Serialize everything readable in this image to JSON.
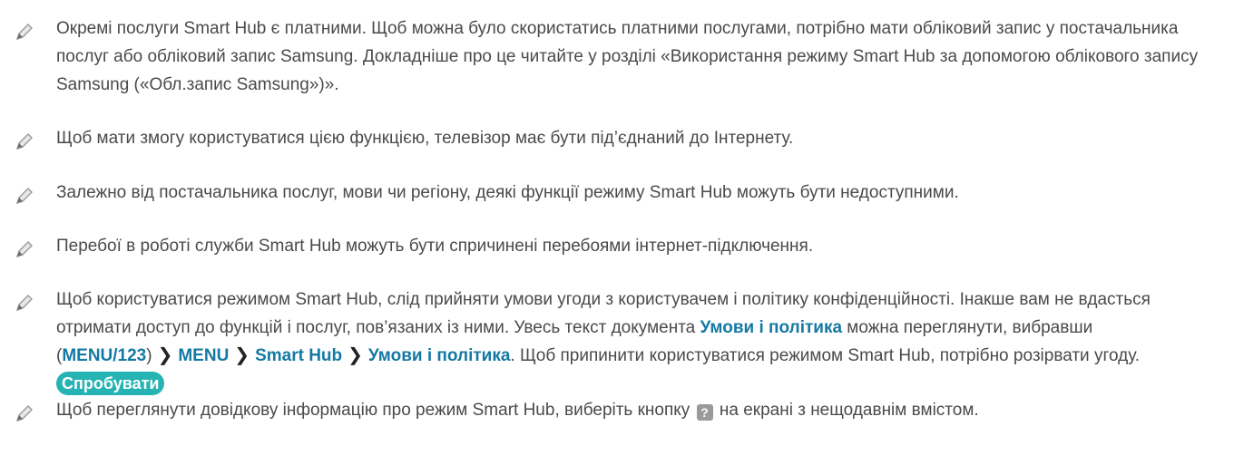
{
  "notes": [
    {
      "text": "Окремі послуги Smart Hub є платними. Щоб можна було скористатись платними послугами, потрібно мати обліковий запис у постачальника послуг або обліковий запис Samsung. Докладніше про це читайте у розділі «Використання режиму Smart Hub за допомогою облікового запису Samsung («Обл.запис Samsung»)»."
    },
    {
      "text": "Щоб мати змогу користуватися цією функцією, телевізор має бути під’єднаний до Інтернету."
    },
    {
      "text": "Залежно від постачальника послуг, мови чи регіону, деякі функції режиму Smart Hub можуть бути недоступними."
    },
    {
      "text": "Перебої в роботі служби Smart Hub можуть бути спричинені перебоями інтернет-підключення."
    },
    {
      "part1": "Щоб користуватися режимом Smart Hub, слід прийняти умови угоди з користувачем і політику конфіденційності. Інакше вам не вдасться отримати доступ до функцій і послуг, пов’язаних із ними. Увесь текст документа ",
      "link_terms": "Умови і політика",
      "part2": " можна переглянути, вибравши (",
      "menu_key": "MENU/123",
      "part3": ")",
      "path_menu": "MENU",
      "path_smarthub": "Smart Hub",
      "path_terms": "Умови і політика",
      "part4": ". Щоб припинити користуватися режимом Smart Hub, потрібно розірвати угоду. ",
      "try_button": "Спробувати"
    },
    {
      "part1": "Щоб переглянути довідкову інформацію про режим Smart Hub, виберіть кнопку ",
      "help_icon": "?",
      "part2": " на екрані з нещодавнім вмістом."
    }
  ],
  "icons": {
    "note": "pencil-icon",
    "path_separator": "chevron-right-icon",
    "help": "help-question-icon"
  },
  "colors": {
    "link": "#1479a3",
    "try_button": "#26b3b3",
    "text": "#4a4a4a"
  }
}
